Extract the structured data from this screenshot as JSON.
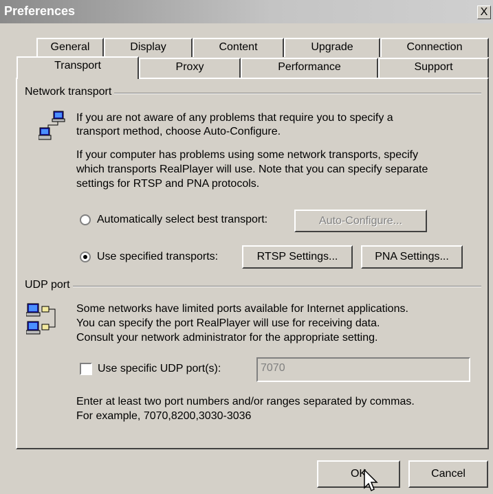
{
  "window": {
    "title": "Preferences",
    "close_label": "X"
  },
  "tabs_back": [
    {
      "label": "General"
    },
    {
      "label": "Display"
    },
    {
      "label": "Content"
    },
    {
      "label": "Upgrade"
    },
    {
      "label": "Connection"
    }
  ],
  "tabs_front": [
    {
      "label": "Transport",
      "selected": true
    },
    {
      "label": "Proxy"
    },
    {
      "label": "Performance"
    },
    {
      "label": "Support"
    }
  ],
  "network_transport": {
    "heading": "Network transport",
    "icon": "network-computers-icon",
    "para1_line1": "If you are not aware of any problems that require you to specify a",
    "para1_line2": "transport method, choose Auto-Configure.",
    "para2_line1": "If your computer has problems using some network transports, specify",
    "para2_line2": "which transports RealPlayer will use. Note that you can specify separate",
    "para2_line3": "settings for RTSP and PNA protocols.",
    "auto_radio_label": "Automatically select best transport:",
    "auto_radio_checked": false,
    "auto_configure_button": "Auto-Configure...",
    "specified_radio_label": "Use specified transports:",
    "specified_radio_checked": true,
    "rtsp_button": "RTSP Settings...",
    "pna_button": "PNA Settings..."
  },
  "udp_port": {
    "heading": "UDP port",
    "icon": "udp-port-icon",
    "para_line1": "Some networks have limited ports available for Internet applications.",
    "para_line2": "You can specify the port RealPlayer will use for receiving data.",
    "para_line3": "Consult your network administrator for the appropriate setting.",
    "checkbox_label": "Use specific UDP port(s):",
    "checkbox_checked": false,
    "port_value": "7070",
    "hint_line1": "Enter at least two port numbers and/or ranges separated by commas.",
    "hint_line2": "For example, 7070,8200,3030-3036"
  },
  "footer": {
    "ok_button": "OK",
    "cancel_button": "Cancel"
  }
}
